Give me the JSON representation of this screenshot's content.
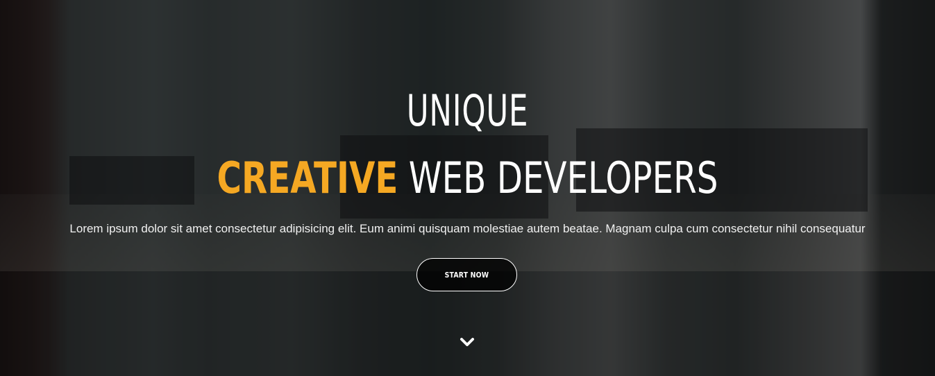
{
  "hero": {
    "title_line1": "UNIQUE",
    "title_accent": "CREATIVE",
    "title_rest": "WEB DEVELOPERS",
    "subtitle": "Lorem ipsum dolor sit amet consectetur adipisicing elit. Eum animi quisquam molestiae autem beatae. Magnam culpa cum consectetur nihil consequatur",
    "cta_label": "START NOW",
    "scroll_icon": "chevron-down-icon"
  },
  "colors": {
    "accent": "#f5a823",
    "text": "#ffffff",
    "overlay": "rgba(10,10,12,0.66)"
  }
}
